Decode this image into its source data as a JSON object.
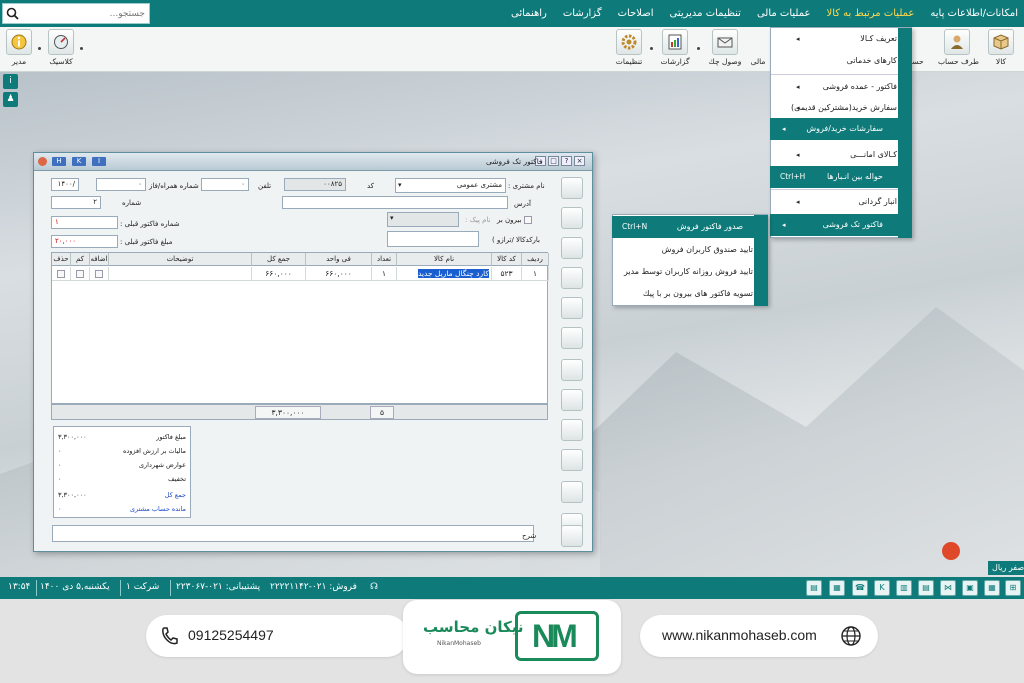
{
  "menubar": {
    "search_placeholder": "جستجو...",
    "items": [
      {
        "label": "امکانات/اطلاعات پایه"
      },
      {
        "label": "عملیات مرتبط به کالا"
      },
      {
        "label": "عملیات مالی"
      },
      {
        "label": "تنظیمات مدیریتی"
      },
      {
        "label": "اصلاحات"
      },
      {
        "label": "گزارشات"
      },
      {
        "label": "راهنمائی"
      }
    ]
  },
  "toolbar": {
    "right": [
      "کالا",
      "طرف حساب",
      "حساب"
    ],
    "mid": [
      "مالی",
      "وصول چك",
      "گزارشات",
      "تنظیمات"
    ],
    "left": [
      "کلاسیک",
      "مدیر"
    ]
  },
  "dropdown_main": {
    "items": [
      {
        "label": "تعریف کـالا"
      },
      {
        "label": "کارهای خدماتی"
      },
      {
        "label": "فاکتور - عمده فروشی"
      },
      {
        "label": "سفارش خرید(مشترکین قدیمی)"
      },
      {
        "label": "سفارشات خرید/فروش"
      },
      {
        "label": "کـالای امانـــی"
      },
      {
        "label": "حواله بین انـبارها",
        "shortcut": "Ctrl+H"
      },
      {
        "label": "انبار گردانی"
      },
      {
        "label": "فاکتور تک فروشی"
      }
    ]
  },
  "dropdown_sub": {
    "items": [
      {
        "label": "صدور فاکتور فروش",
        "shortcut": "Ctrl+N"
      },
      {
        "label": "تایید صندوق کاربران فروش"
      },
      {
        "label": "تایید فروش روزانه کاربران توسط مدیر"
      },
      {
        "label": "تسویه فاکتور های بیرون بر با پیك"
      }
    ]
  },
  "invoice": {
    "title": "فاکتور تک فروشی",
    "title_buttons": [
      "H",
      "K",
      "I"
    ],
    "fields": {
      "date": "۱۴۰۰/",
      "mobile_label": "شماره همراه/فاز",
      "mobile": "۰",
      "phone_label": "تلفن",
      "phone": "۰",
      "code_value": "۰۰۸۲۵",
      "code_label": "کد",
      "customer_value": "مشتری عمومی",
      "customer_label": "نام مشتری :",
      "address_label": "آدرس",
      "number_label": "شماره",
      "number_value": "۲",
      "courier_label": "بیرون بر",
      "courier_name_label": "نام پیک :",
      "prev_no_label": "شماره فاکتور قبلی :",
      "prev_no_value": "۱",
      "prev_amount_label": "مبلغ فاکتور قبلی :",
      "prev_amount_value": "۲۰,۰۰۰",
      "barcode_label": "بارکدکالا /ترازو )"
    },
    "columns": [
      "ردیف",
      "کد کالا",
      "نام کالا",
      "تعداد",
      "فی واحد",
      "جمع کل",
      "توضیحات",
      "اضافه",
      "کم",
      "حذف"
    ],
    "rows": [
      {
        "row": "۱",
        "code": "۵۲۳",
        "name": "کارد چنگال ماریل جدید",
        "qty": "۱",
        "unit": "۶۶۰,۰۰۰",
        "total": "۶۶۰,۰۰۰",
        "desc": ""
      }
    ],
    "summary": {
      "count": "۵",
      "total": "۳,۳۰۰,۰۰۰"
    },
    "totals": [
      {
        "label": "مبلغ فاکتور",
        "value": "۳,۳۰۰,۰۰۰"
      },
      {
        "label": "مالیات بر ارزش افزوده",
        "value": "۰"
      },
      {
        "label": "عوارض شهرداری",
        "value": "۰"
      },
      {
        "label": "تخفیف",
        "value": "۰"
      },
      {
        "label": "جمع کل",
        "value": "۳,۳۰۰,۰۰۰"
      },
      {
        "label": "مانده حساب مشتری",
        "value": "۰"
      }
    ],
    "notes_label": "شرح"
  },
  "desktop_label": "صفر ریال",
  "statusbar": {
    "time": "۱۳:۵۴",
    "date": "یکشنبه,۵ دی ۱۴۰۰",
    "company": "شرکت ۱",
    "sales_phone": "فروش: ۰۲۱-۲۲۲۲۱۱۴۲",
    "support_phone": "پشتیبانی: ۰۲۱-۲۲۳۰۶۷"
  },
  "footer": {
    "phone": "09125254497",
    "brand_fa": "نیکان محاسب",
    "brand_en": "NikanMohaseb",
    "logo": "NM",
    "website": "www.nikanmohaseb.com"
  },
  "colors": {
    "teal": "#0e7b7a",
    "highlight": "#1a5fd0",
    "brand_green": "#1b8a5a"
  }
}
